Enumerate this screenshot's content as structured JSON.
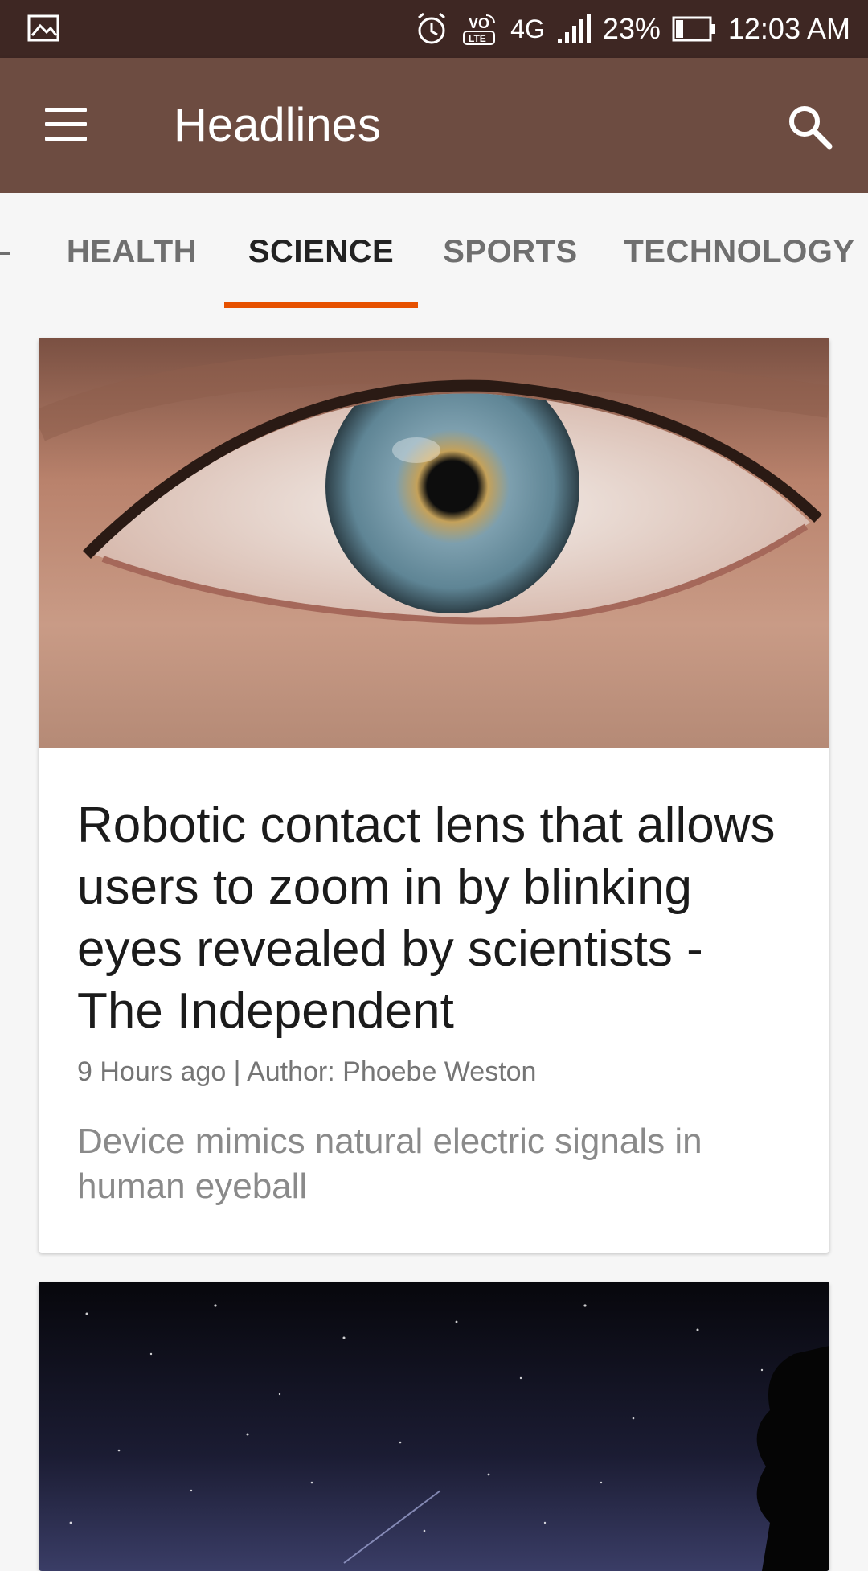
{
  "status_bar": {
    "battery_percent": "23%",
    "network": "4G",
    "time": "12:03 AM",
    "icons": [
      "gallery-icon",
      "alarm-icon",
      "volte-icon",
      "network-4g-icon",
      "signal-icon",
      "battery-icon"
    ]
  },
  "app_bar": {
    "title": "Headlines",
    "menu_icon": "hamburger-menu-icon",
    "search_icon": "search-icon",
    "color": "#6d4c41"
  },
  "tabs": {
    "items": [
      {
        "label": "HEALTH"
      },
      {
        "label": "SCIENCE",
        "selected": true
      },
      {
        "label": "SPORTS"
      },
      {
        "label": "TECHNOLOGY"
      }
    ],
    "indicator_color": "#e65100"
  },
  "articles": [
    {
      "image": "eye-closeup-photo",
      "headline": "Robotic contact lens that allows users to zoom in by blinking eyes revealed by scientists - The Independent",
      "meta": "9 Hours ago | Author: Phoebe Weston",
      "description": "Device mimics natural electric signals in human eyeball"
    },
    {
      "image": "night-sky-stars-photo"
    }
  ]
}
